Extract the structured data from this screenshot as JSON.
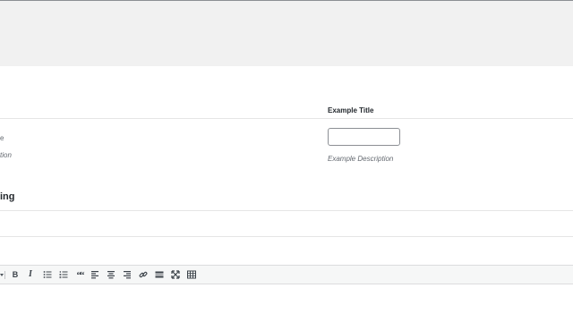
{
  "field": {
    "title": "Example Title",
    "input_value": "",
    "description": "Example Description"
  },
  "left_fragments": {
    "line1": "e",
    "line2": "tion",
    "heading": "ing"
  },
  "toolbar": {
    "bold": "B",
    "italic": "I",
    "blockquote": "““"
  }
}
